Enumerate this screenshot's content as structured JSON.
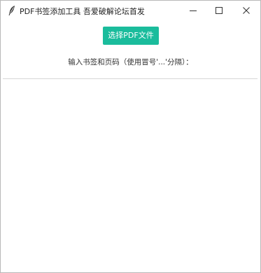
{
  "window": {
    "title": "PDF书签添加工具 吾爱破解论坛首发",
    "controls": {
      "minimize_icon": "minimize-icon",
      "maximize_icon": "maximize-icon",
      "close_icon": "close-icon"
    },
    "app_icon": "feather-icon"
  },
  "main": {
    "select_button_label": "选择PDF文件",
    "hint_label": "输入书签和页码（使用冒号'...'分隔）：",
    "bookmark_input_value": ""
  },
  "colors": {
    "accent": "#1abc9c",
    "background": "#ffffff"
  }
}
